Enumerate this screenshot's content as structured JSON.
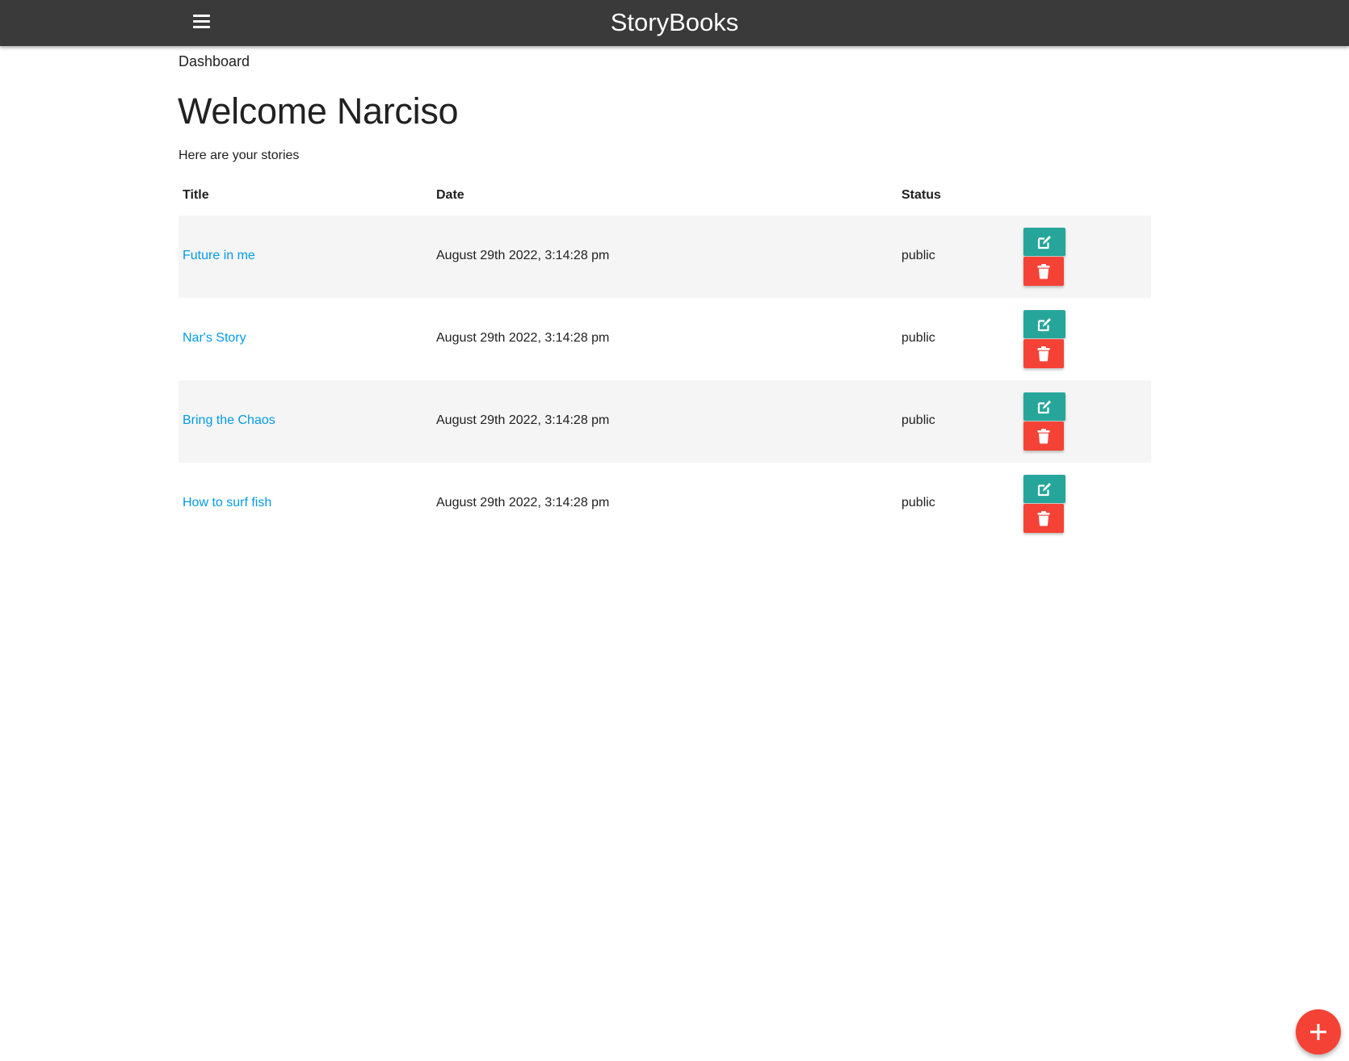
{
  "navbar": {
    "brand": "StoryBooks",
    "menu_icon": "hamburger-menu-icon",
    "color": "#3a3a3a"
  },
  "breadcrumb": "Dashboard",
  "welcome": "Welcome Narciso",
  "subtitle": "Here are your stories",
  "table": {
    "headers": {
      "title": "Title",
      "date": "Date",
      "status": "Status"
    },
    "rows": [
      {
        "title": "Future in me",
        "date": "August 29th 2022, 3:14:28 pm",
        "status": "public"
      },
      {
        "title": "Nar's Story",
        "date": "August 29th 2022, 3:14:28 pm",
        "status": "public"
      },
      {
        "title": "Bring the Chaos",
        "date": "August 29th 2022, 3:14:28 pm",
        "status": "public"
      },
      {
        "title": "How to surf fish",
        "date": "August 29th 2022, 3:14:28 pm",
        "status": "public"
      }
    ],
    "edit_icon": "edit-icon",
    "delete_icon": "trash-icon"
  },
  "fab": {
    "icon": "plus-icon"
  },
  "colors": {
    "link": "#039be5",
    "edit": "#26a69a",
    "delete": "#f44336",
    "row_stripe": "#f5f5f5"
  }
}
